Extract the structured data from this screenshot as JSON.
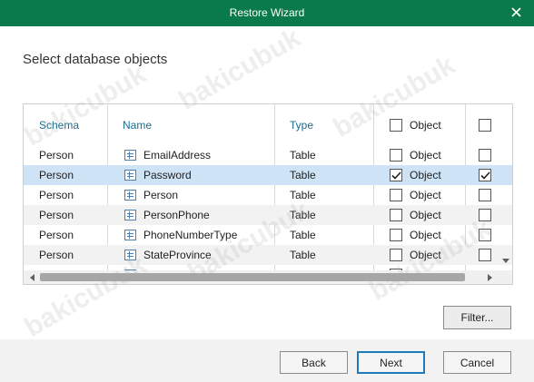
{
  "window": {
    "title": "Restore Wizard"
  },
  "page": {
    "title": "Select database objects"
  },
  "table": {
    "headers": {
      "schema": "Schema",
      "name": "Name",
      "type": "Type",
      "object1": "Object",
      "object2": ""
    },
    "rows": [
      {
        "schema": "Person",
        "name": "EmailAddress",
        "type": "Table",
        "object": "Object",
        "checked1": false,
        "checked2": false,
        "selected": false
      },
      {
        "schema": "Person",
        "name": "Password",
        "type": "Table",
        "object": "Object",
        "checked1": true,
        "checked2": true,
        "selected": true
      },
      {
        "schema": "Person",
        "name": "Person",
        "type": "Table",
        "object": "Object",
        "checked1": false,
        "checked2": false,
        "selected": false
      },
      {
        "schema": "Person",
        "name": "PersonPhone",
        "type": "Table",
        "object": "Object",
        "checked1": false,
        "checked2": false,
        "selected": false
      },
      {
        "schema": "Person",
        "name": "PhoneNumberType",
        "type": "Table",
        "object": "Object",
        "checked1": false,
        "checked2": false,
        "selected": false
      },
      {
        "schema": "Person",
        "name": "StateProvince",
        "type": "Table",
        "object": "Object",
        "checked1": false,
        "checked2": false,
        "selected": false
      }
    ]
  },
  "buttons": {
    "filter": "Filter...",
    "back": "Back",
    "next": "Next",
    "cancel": "Cancel"
  },
  "watermark": "bakicubuk",
  "colors": {
    "titlebar": "#0a7a4a",
    "selection": "#cfe3f6",
    "header_text": "#1a6d8f"
  }
}
